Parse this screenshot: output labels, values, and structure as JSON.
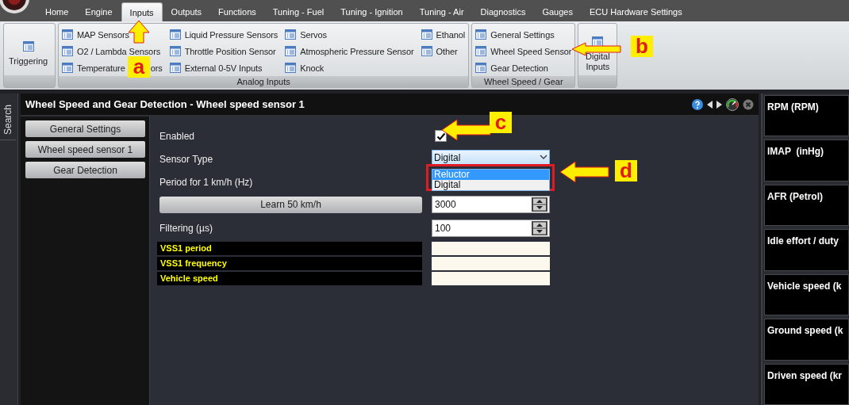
{
  "tabs": [
    {
      "label": "Home",
      "selected": false
    },
    {
      "label": "Engine",
      "selected": false
    },
    {
      "label": "Inputs",
      "selected": true
    },
    {
      "label": "Outputs",
      "selected": false
    },
    {
      "label": "Functions",
      "selected": false
    },
    {
      "label": "Tuning - Fuel",
      "selected": false
    },
    {
      "label": "Tuning - Ignition",
      "selected": false
    },
    {
      "label": "Tuning - Air",
      "selected": false
    },
    {
      "label": "Diagnostics",
      "selected": false
    },
    {
      "label": "Gauges",
      "selected": false
    },
    {
      "label": "ECU Hardware Settings",
      "selected": false
    }
  ],
  "ribbon": {
    "groups": [
      {
        "kind": "large",
        "label": "Triggering"
      },
      {
        "kind": "list",
        "caption": "Analog Inputs",
        "columns": [
          [
            "MAP Sensors",
            "O2 / Lambda Sensors",
            [
              "Temperature",
              "ors"
            ]
          ],
          [
            "Liquid Pressure Sensors",
            "Throttle Position Sensor",
            "External 0-5V Inputs"
          ],
          [
            "Servos",
            "Atmospheric Pressure Sensor",
            "Knock"
          ],
          [
            "Ethanol",
            "Other"
          ]
        ]
      },
      {
        "kind": "list",
        "caption": "Wheel Speed / Gear",
        "columns": [
          [
            "General Settings",
            "Wheel Speed Sensor",
            "Gear Detection"
          ]
        ]
      },
      {
        "kind": "large",
        "label": "Digital Inputs"
      }
    ]
  },
  "side_tab": "Search",
  "panel": {
    "title": "Wheel Speed and Gear Detection - Wheel speed sensor 1",
    "nav": [
      "General Settings",
      "Wheel speed sensor 1",
      "Gear Detection"
    ],
    "fields": [
      {
        "kind": "checkbox",
        "label": "Enabled",
        "checked": true
      },
      {
        "kind": "select",
        "label": "Sensor Type",
        "value": "Digital",
        "open": true,
        "options": [
          {
            "label": "Reluctor",
            "highlighted": true
          },
          {
            "label": "Digital",
            "highlighted": false
          }
        ]
      },
      {
        "kind": "heading",
        "label": "Period for 1 km/h (Hz)"
      },
      {
        "kind": "button-spin",
        "button": "Learn 50 km/h",
        "value": "3000"
      },
      {
        "kind": "spin",
        "label": "Filtering (µs)",
        "value": "100"
      }
    ],
    "readouts": [
      "VSS1 period",
      "VSS1 frequency",
      "Vehicle speed"
    ]
  },
  "gauges": [
    "RPM (RPM)",
    "IMAP  (inHg)",
    "AFR (Petrol)",
    "Idle effort / duty",
    "Vehicle speed (k",
    "Ground speed (k",
    "Driven speed (kr"
  ],
  "annotations": [
    {
      "letter": "a",
      "kind": "upward",
      "highlight": false
    },
    {
      "letter": "b",
      "kind": "leftward",
      "highlight": false
    },
    {
      "letter": "c",
      "kind": "leftward",
      "highlight": false
    },
    {
      "letter": "d",
      "kind": "leftward",
      "highlight": true
    }
  ]
}
